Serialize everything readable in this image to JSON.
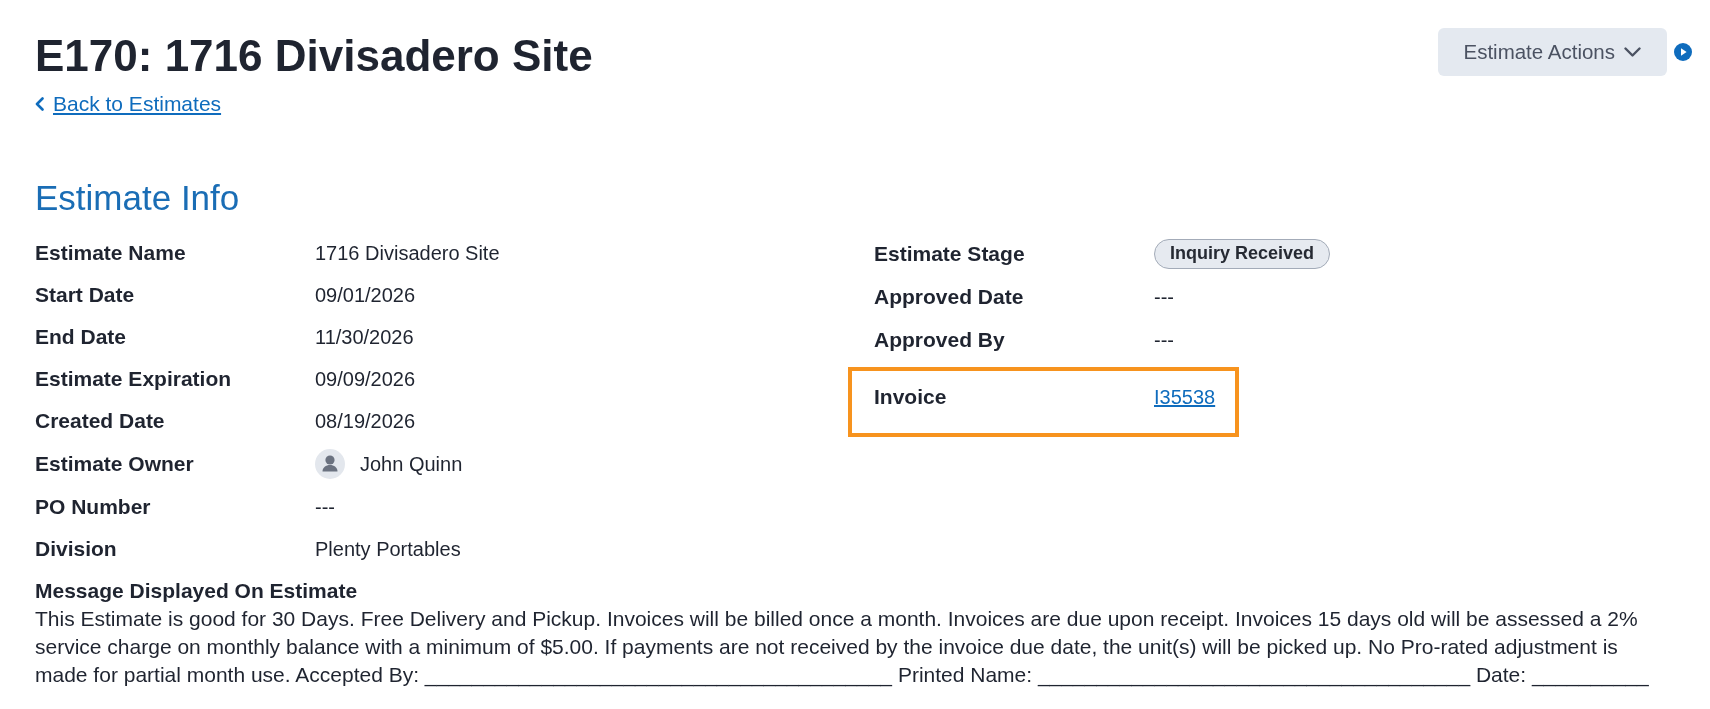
{
  "header": {
    "title": "E170: 1716 Divisadero Site",
    "back_link": "Back to Estimates",
    "actions_button": "Estimate Actions"
  },
  "section": {
    "title": "Estimate Info",
    "left_fields": [
      {
        "label": "Estimate Name",
        "value": "1716 Divisadero Site",
        "kind": "text"
      },
      {
        "label": "Start Date",
        "value": "09/01/2026",
        "kind": "text"
      },
      {
        "label": "End Date",
        "value": "11/30/2026",
        "kind": "text"
      },
      {
        "label": "Estimate Expiration",
        "value": "09/09/2026",
        "kind": "text"
      },
      {
        "label": "Created Date",
        "value": "08/19/2026",
        "kind": "text"
      },
      {
        "label": "Estimate Owner",
        "value": "John Quinn",
        "kind": "user"
      },
      {
        "label": "PO Number",
        "value": "---",
        "kind": "text"
      },
      {
        "label": "Division",
        "value": "Plenty Portables",
        "kind": "text"
      }
    ],
    "right_fields": [
      {
        "label": "Estimate Stage",
        "value": "Inquiry Received",
        "kind": "badge",
        "highlighted": false
      },
      {
        "label": "Approved Date",
        "value": "---",
        "kind": "text",
        "highlighted": false
      },
      {
        "label": "Approved By",
        "value": "---",
        "kind": "text",
        "highlighted": false
      },
      {
        "label": "Invoice",
        "value": "I35538",
        "kind": "link",
        "highlighted": true
      }
    ]
  },
  "message": {
    "title": "Message Displayed On Estimate",
    "text": "This Estimate is good for 30 Days. Free Delivery and Pickup. Invoices will be billed once a month. Invoices are due upon receipt. Invoices 15 days old will be assessed a 2% service charge on monthly balance with a minimum of $5.00. If payments are not received by the invoice due date, the unit(s) will be picked up. No Pro-rated adjustment is made for partial month use. Accepted By: ________________________________________ Printed Name: _____________________________________ Date: __________"
  }
}
